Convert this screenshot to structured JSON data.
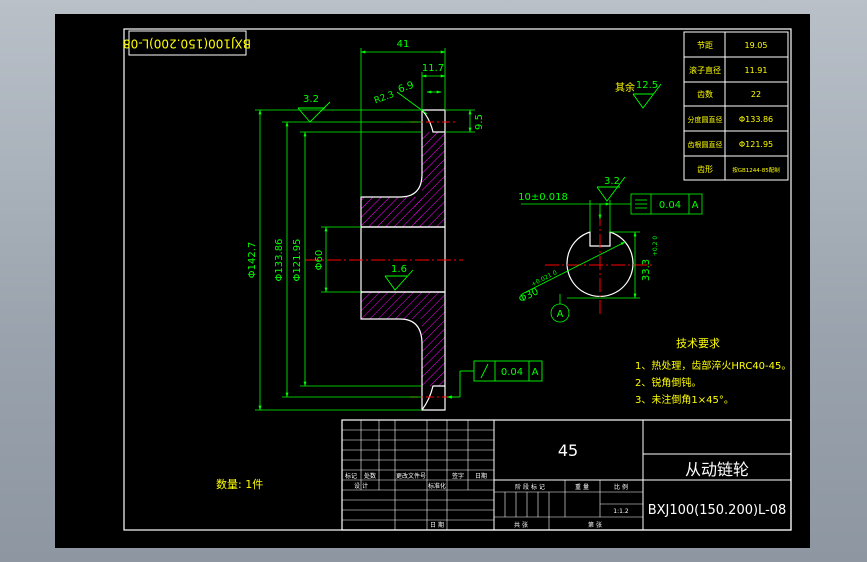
{
  "title_block": {
    "upside_code": "BXJ100(150.200)L-08",
    "material": "45",
    "part_name": "从动链轮",
    "drawing_number": "BXJ100(150.200)L-08",
    "scale": "1:1.2",
    "quantity": "数量: 1件",
    "hdr_mark": "标记",
    "hdr_count": "处数",
    "hdr_file": "更改文件号",
    "hdr_sign": "签字",
    "hdr_date": "日期",
    "row_design": "设 计",
    "row_std": "标准化",
    "stage_label": "阶 段 标 记",
    "weight_label": "重 量",
    "scale_label": "比 例",
    "approve_label": "共  张",
    "sheet_label": "第  张",
    "date_label": "日 期"
  },
  "params": [
    {
      "name": "节距",
      "value": "19.05"
    },
    {
      "name": "滚子直径",
      "value": "11.91"
    },
    {
      "name": "齿数",
      "value": "22"
    },
    {
      "name": "分度圆直径",
      "value": "Φ133.86"
    },
    {
      "name": "齿根圆直径",
      "value": "Φ121.95"
    },
    {
      "name": "齿形",
      "value": "按GB1244-85配制"
    }
  ],
  "dims": {
    "d41": "41",
    "d117": "11.7",
    "d69": "6.9",
    "dr": "R2.3",
    "d95": "9.5",
    "rough32a": "3.2",
    "d1427": "Φ142.7",
    "d13386": "Φ133.86",
    "d12195": "Φ121.95",
    "d60": "Φ60",
    "rough16": "1.6",
    "runout_val": "0.04",
    "runout_ref": "A",
    "rest_label": "其余",
    "rough125": "12.5",
    "key_width": "10±0.018",
    "rough32b": "3.2",
    "sym_val": "0.04",
    "sym_ref": "A",
    "key_depth": "33.3",
    "key_tol": "+0.2\n0",
    "bore": "Φ30",
    "bore_tol": "+0.021\n0",
    "datum": "A"
  },
  "notes": {
    "title": "技术要求",
    "items": [
      "1、热处理，齿部淬火HRC40-45。",
      "2、锐角倒钝。",
      "3、未注倒角1×45°。"
    ]
  },
  "colors": {
    "background": "#000000",
    "outline": "#ffffff",
    "dimension": "#00ff00",
    "centerline": "#ff0000",
    "text": "#ffff00",
    "hatch": "#ff00ff"
  }
}
